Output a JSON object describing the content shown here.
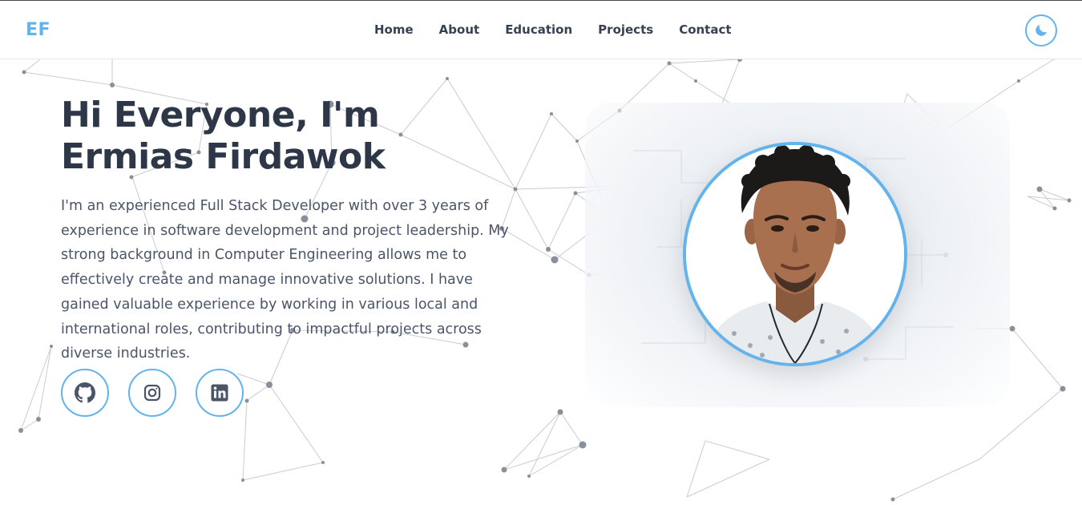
{
  "navbar": {
    "logo": "EF",
    "links": [
      "Home",
      "About",
      "Education",
      "Projects",
      "Contact"
    ],
    "theme_toggle_icon": "moon-icon"
  },
  "hero": {
    "title": "Hi Everyone, I'm Ermias Firdawok",
    "description": "I'm an experienced Full Stack Developer with over 3 years of experience in software development and project leadership. My strong background in Computer Engineering allows me to effectively create and manage innovative solutions. I have gained valuable experience by working in various local and international roles, contributing to impactful projects across diverse industries.",
    "socials": [
      {
        "name": "GitHub",
        "icon": "github-icon"
      },
      {
        "name": "Instagram",
        "icon": "instagram-icon"
      },
      {
        "name": "LinkedIn",
        "icon": "linkedin-icon"
      }
    ],
    "avatar_icon": "profile-photo"
  },
  "colors": {
    "accent": "#63b3ed",
    "heading": "#2d3748",
    "text": "#4a5568",
    "network_lines": "#c8cbd0",
    "network_nodes": "#8a9099"
  }
}
